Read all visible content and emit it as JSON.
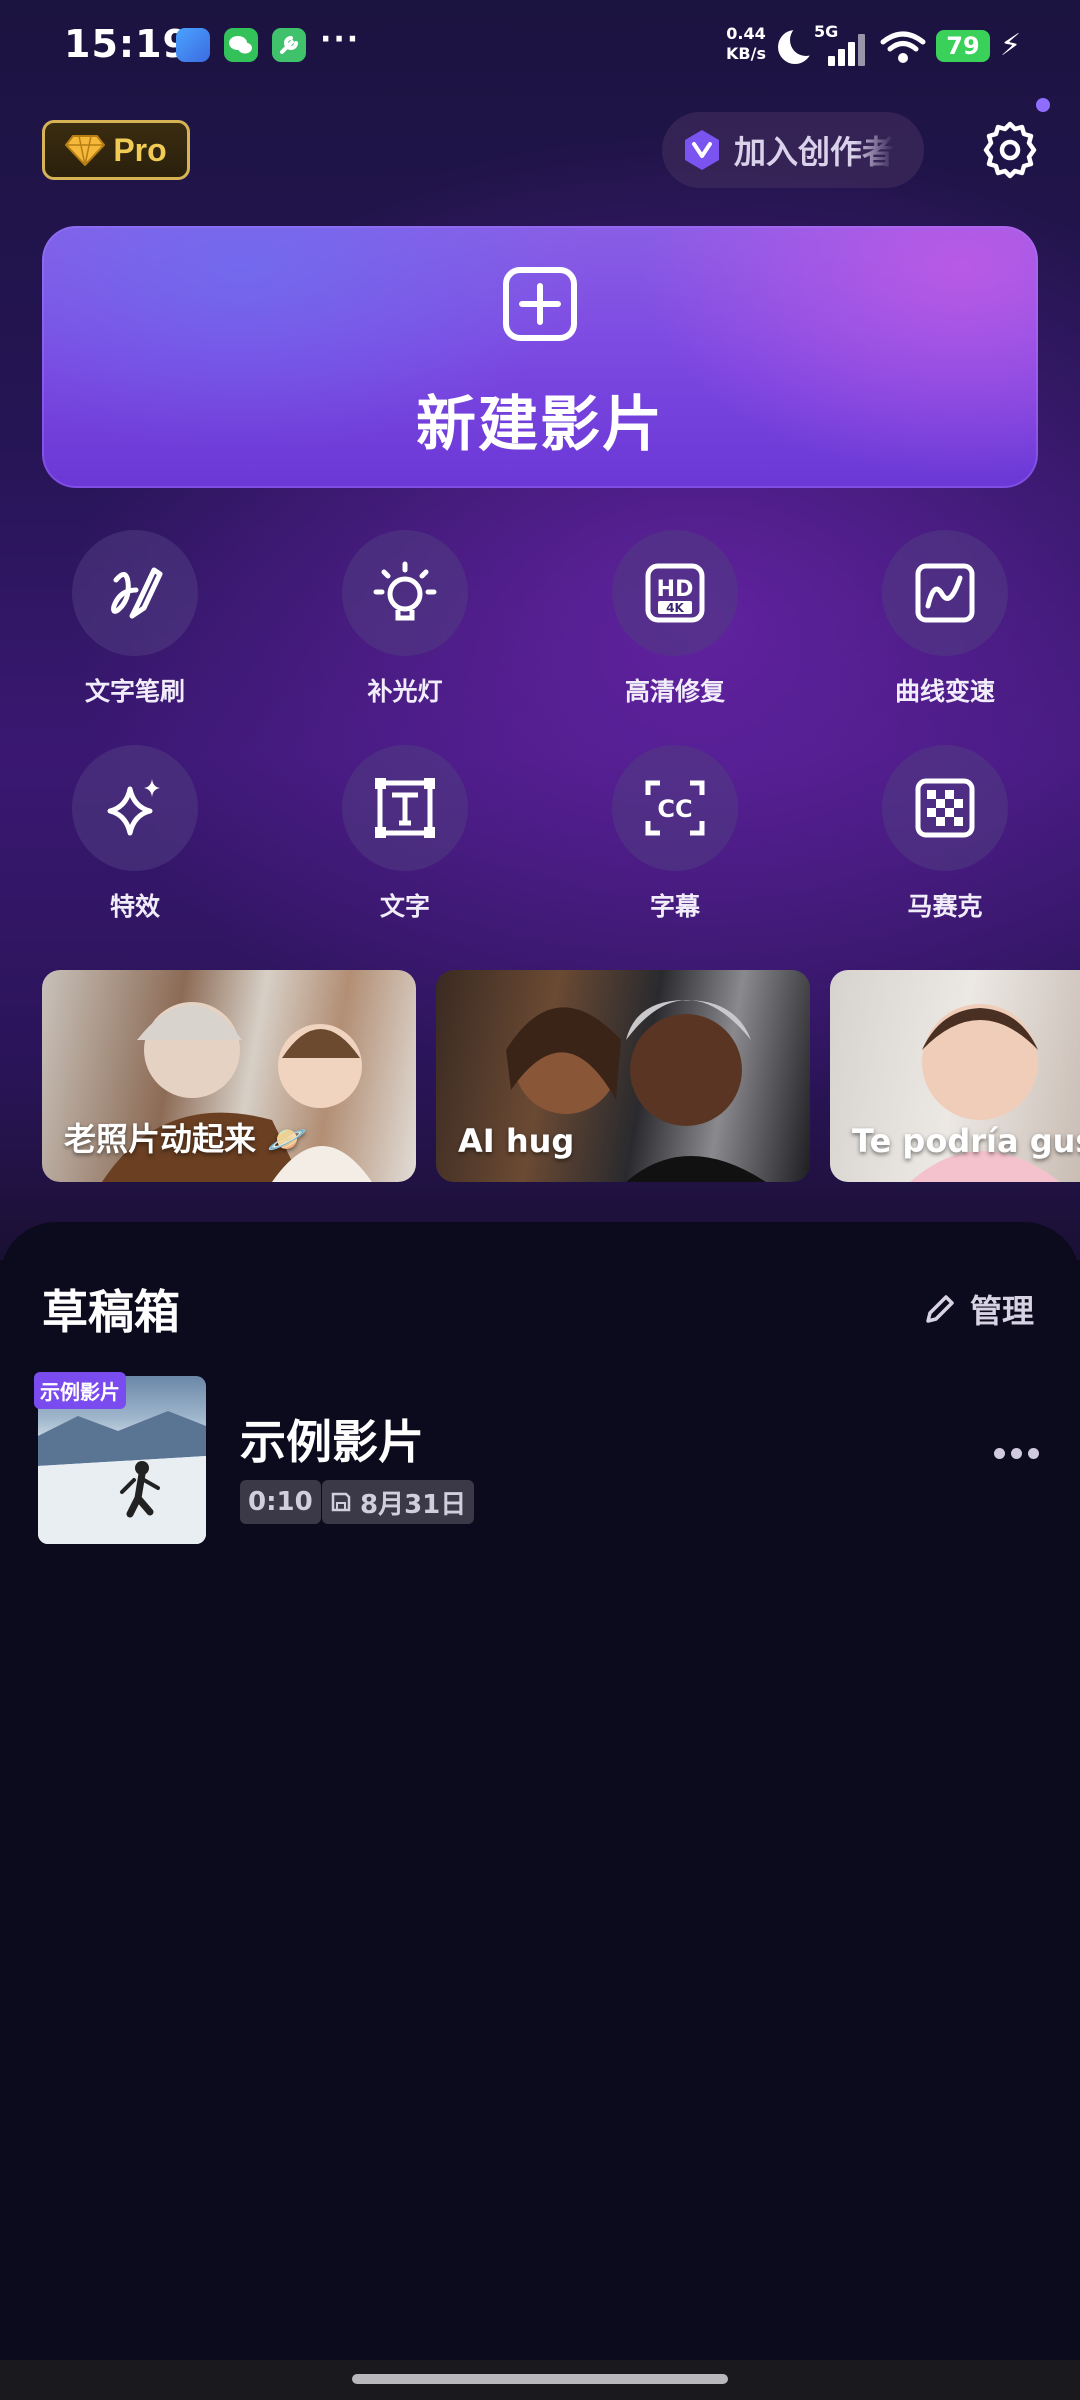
{
  "status_bar": {
    "time": "15:19",
    "net_speed_value": "0.44",
    "net_speed_unit": "KB/s",
    "network": "5G",
    "battery": "79",
    "icons": [
      "app-icon",
      "wechat-icon",
      "tool-icon",
      "more-dots-icon",
      "moon-icon",
      "signal-icon",
      "wifi-icon",
      "battery-icon",
      "charging-icon"
    ]
  },
  "header": {
    "pro_label": "Pro",
    "creator_button": "加入创作者",
    "settings_icon": "gear-icon"
  },
  "new_film": {
    "label": "新建影片",
    "icon": "plus-square-icon"
  },
  "tools": [
    {
      "label": "文字笔刷",
      "icon": "text-brush-icon"
    },
    {
      "label": "补光灯",
      "icon": "light-bulb-icon"
    },
    {
      "label": "高清修复",
      "icon": "hd-4k-icon"
    },
    {
      "label": "曲线变速",
      "icon": "curve-speed-icon"
    },
    {
      "label": "特效",
      "icon": "sparkle-icon"
    },
    {
      "label": "文字",
      "icon": "text-box-icon"
    },
    {
      "label": "字幕",
      "icon": "cc-icon"
    },
    {
      "label": "马赛克",
      "icon": "mosaic-icon"
    }
  ],
  "templates": [
    {
      "label": "老照片动起来 🪐"
    },
    {
      "label": "AI hug"
    },
    {
      "label": "Te podría gusta"
    }
  ],
  "drafts": {
    "title": "草稿箱",
    "manage_label": "管理",
    "items": [
      {
        "badge": "示例影片",
        "title": "示例影片",
        "duration": "0:10",
        "date": "8月31日"
      }
    ]
  },
  "colors": {
    "accent": "#7a4cf0",
    "pro_gold": "#f0cc55",
    "battery": "#3ad15a",
    "background": "#0c0a1d"
  }
}
